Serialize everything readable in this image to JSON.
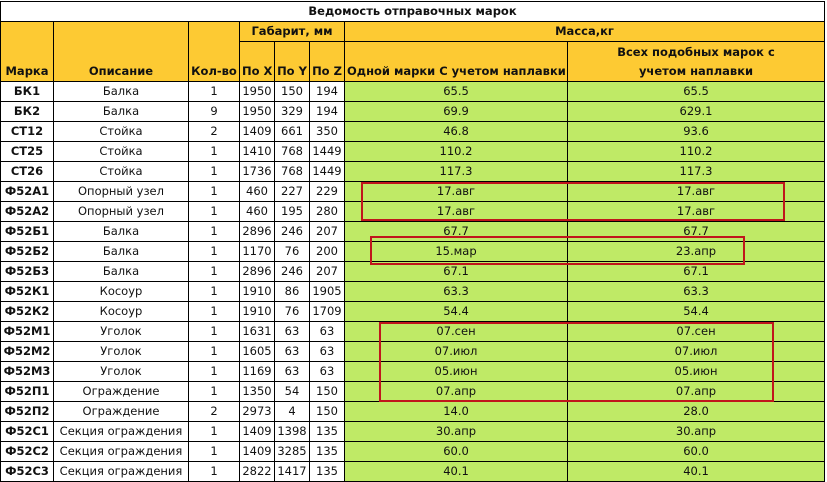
{
  "title": "Ведомость отправочных марок",
  "headers": {
    "mark": "Марка",
    "description": "Описание",
    "qty": "Кол-во",
    "dims_group": "Габарит, мм",
    "x": "По X",
    "y": "По Y",
    "z": "По Z",
    "mass_group": "Масса,кг",
    "mass_one": "Одной марки С учетом наплавки",
    "mass_all": "Всех подобных марок с учетом наплавки"
  },
  "rows": [
    {
      "mark": "БК1",
      "desc": "Балка",
      "qty": "1",
      "x": "1950",
      "y": "150",
      "z": "194",
      "one": "65.5",
      "all": "65.5"
    },
    {
      "mark": "БК2",
      "desc": "Балка",
      "qty": "9",
      "x": "1950",
      "y": "329",
      "z": "194",
      "one": "69.9",
      "all": "629.1"
    },
    {
      "mark": "СТ12",
      "desc": "Стойка",
      "qty": "2",
      "x": "1409",
      "y": "661",
      "z": "350",
      "one": "46.8",
      "all": "93.6"
    },
    {
      "mark": "СТ25",
      "desc": "Стойка",
      "qty": "1",
      "x": "1410",
      "y": "768",
      "z": "1449",
      "one": "110.2",
      "all": "110.2"
    },
    {
      "mark": "СТ26",
      "desc": "Стойка",
      "qty": "1",
      "x": "1736",
      "y": "768",
      "z": "1449",
      "one": "117.3",
      "all": "117.3"
    },
    {
      "mark": "Ф52А1",
      "desc": "Опорный узел",
      "qty": "1",
      "x": "460",
      "y": "227",
      "z": "229",
      "one": "17.авг",
      "all": "17.авг"
    },
    {
      "mark": "Ф52А2",
      "desc": "Опорный узел",
      "qty": "1",
      "x": "460",
      "y": "195",
      "z": "280",
      "one": "17.авг",
      "all": "17.авг"
    },
    {
      "mark": "Ф52Б1",
      "desc": "Балка",
      "qty": "1",
      "x": "2896",
      "y": "246",
      "z": "207",
      "one": "67.7",
      "all": "67.7"
    },
    {
      "mark": "Ф52Б2",
      "desc": "Балка",
      "qty": "1",
      "x": "1170",
      "y": "76",
      "z": "200",
      "one": "15.мар",
      "all": "23.апр"
    },
    {
      "mark": "Ф52Б3",
      "desc": "Балка",
      "qty": "1",
      "x": "2896",
      "y": "246",
      "z": "207",
      "one": "67.1",
      "all": "67.1"
    },
    {
      "mark": "Ф52К1",
      "desc": "Косоур",
      "qty": "1",
      "x": "1910",
      "y": "86",
      "z": "1905",
      "one": "63.3",
      "all": "63.3"
    },
    {
      "mark": "Ф52К2",
      "desc": "Косоур",
      "qty": "1",
      "x": "1910",
      "y": "76",
      "z": "1709",
      "one": "54.4",
      "all": "54.4"
    },
    {
      "mark": "Ф52М1",
      "desc": "Уголок",
      "qty": "1",
      "x": "1631",
      "y": "63",
      "z": "63",
      "one": "07.сен",
      "all": "07.сен"
    },
    {
      "mark": "Ф52М2",
      "desc": "Уголок",
      "qty": "1",
      "x": "1605",
      "y": "63",
      "z": "63",
      "one": "07.июл",
      "all": "07.июл"
    },
    {
      "mark": "Ф52М3",
      "desc": "Уголок",
      "qty": "1",
      "x": "1169",
      "y": "63",
      "z": "63",
      "one": "05.июн",
      "all": "05.июн"
    },
    {
      "mark": "Ф52П1",
      "desc": "Ограждение",
      "qty": "1",
      "x": "1350",
      "y": "54",
      "z": "150",
      "one": "07.апр",
      "all": "07.апр"
    },
    {
      "mark": "Ф52П2",
      "desc": "Ограждение",
      "qty": "2",
      "x": "2973",
      "y": "4",
      "z": "150",
      "one": "14.0",
      "all": "28.0"
    },
    {
      "mark": "Ф52С1",
      "desc": "Секция ограждения",
      "qty": "1",
      "x": "1409",
      "y": "1398",
      "z": "135",
      "one": "30.апр",
      "all": "30.апр"
    },
    {
      "mark": "Ф52С2",
      "desc": "Секция ограждения",
      "qty": "1",
      "x": "1409",
      "y": "3285",
      "z": "135",
      "one": "60.0",
      "all": "60.0"
    },
    {
      "mark": "Ф52С3",
      "desc": "Секция ограждения",
      "qty": "1",
      "x": "2822",
      "y": "1417",
      "z": "135",
      "one": "40.1",
      "all": "40.1"
    }
  ],
  "colors": {
    "header": "#fdca33",
    "mass": "#bfea66",
    "highlight": "#c0161c"
  }
}
